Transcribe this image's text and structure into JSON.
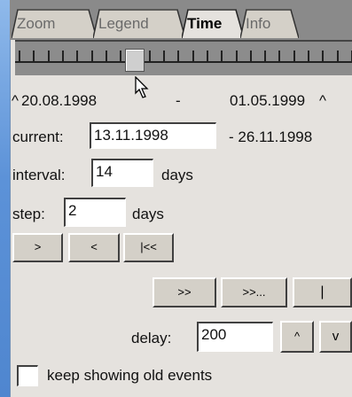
{
  "tabs": [
    {
      "label": "Zoom",
      "active": false
    },
    {
      "label": "Legend",
      "active": false
    },
    {
      "label": "Time",
      "active": true
    },
    {
      "label": "Info",
      "active": false
    }
  ],
  "range": {
    "start": "20.08.1998",
    "separator": "-",
    "end": "01.05.1999",
    "marker": "^"
  },
  "current": {
    "label": "current:",
    "value": "13.11.1998",
    "end_text": "- 26.11.1998"
  },
  "interval": {
    "label": "interval:",
    "value": "14",
    "unit": "days"
  },
  "step": {
    "label": "step:",
    "value": "2",
    "unit": "days"
  },
  "nav_buttons": {
    "forward": ">",
    "back": "<",
    "to_start": "|<<"
  },
  "play_buttons": {
    "fast_forward": ">>",
    "play_all": ">>...",
    "stop": "|"
  },
  "delay": {
    "label": "delay:",
    "value": "200",
    "up": "^",
    "down": "v"
  },
  "keep_old": {
    "label": "keep showing old events",
    "checked": false
  },
  "colors": {
    "panel": "#e5e2de",
    "timeline": "#8c8c8c",
    "window_strip": "#5c92d8"
  }
}
